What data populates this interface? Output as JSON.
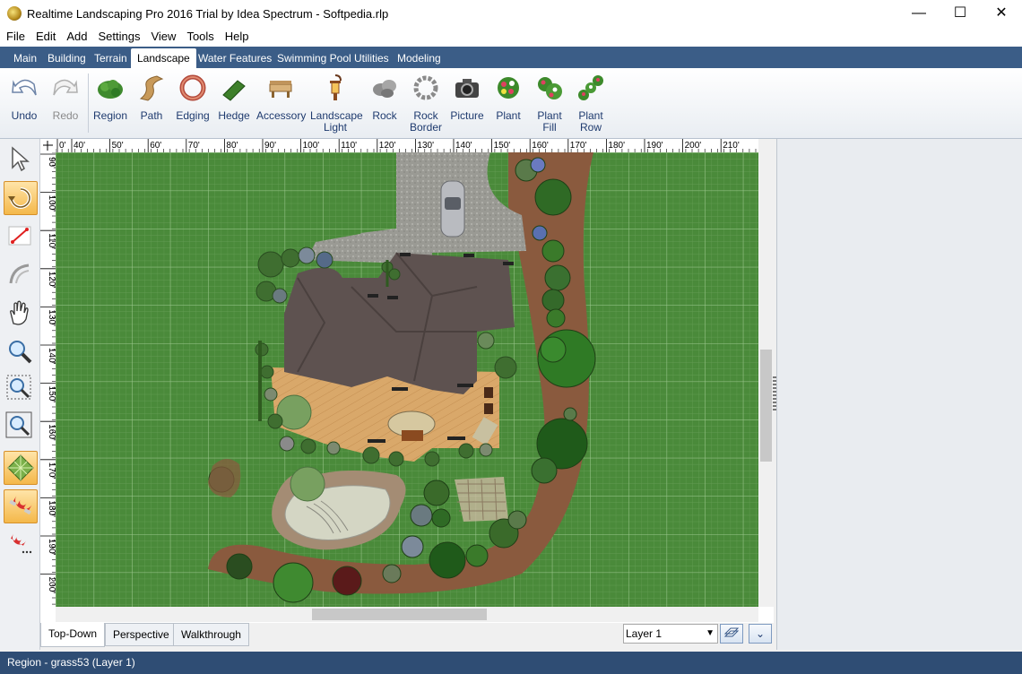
{
  "window": {
    "title": "Realtime Landscaping Pro 2016 Trial by Idea Spectrum - Softpedia.rlp",
    "minimize": "—",
    "maximize": "☐",
    "close": "✕"
  },
  "menu": [
    "File",
    "Edit",
    "Add",
    "Settings",
    "View",
    "Tools",
    "Help"
  ],
  "tabs": [
    "Main",
    "Building",
    "Terrain",
    "Landscape",
    "Water Features",
    "Swimming Pool",
    "Utilities",
    "Modeling"
  ],
  "active_tab": "Landscape",
  "ribbon": {
    "undo": "Undo",
    "redo": "Redo",
    "items": [
      {
        "line1": "Region",
        "line2": "",
        "icon": "region-icon"
      },
      {
        "line1": "Path",
        "line2": "",
        "icon": "path-icon"
      },
      {
        "line1": "Edging",
        "line2": "",
        "icon": "edging-icon"
      },
      {
        "line1": "Hedge",
        "line2": "",
        "icon": "hedge-icon"
      },
      {
        "line1": "Accessory",
        "line2": "",
        "icon": "accessory-icon"
      },
      {
        "line1": "Landscape",
        "line2": "Light",
        "icon": "lantern-icon"
      },
      {
        "line1": "Rock",
        "line2": "",
        "icon": "rock-icon"
      },
      {
        "line1": "Rock",
        "line2": "Border",
        "icon": "rock-border-icon"
      },
      {
        "line1": "Picture",
        "line2": "",
        "icon": "camera-icon"
      },
      {
        "line1": "Plant",
        "line2": "",
        "icon": "plant-icon"
      },
      {
        "line1": "Plant",
        "line2": "Fill",
        "icon": "plant-fill-icon"
      },
      {
        "line1": "Plant",
        "line2": "Row",
        "icon": "plant-row-icon"
      }
    ]
  },
  "ruler": {
    "top": [
      "0'",
      "40'",
      "50'",
      "60'",
      "70'",
      "80'",
      "90'",
      "100'",
      "110'",
      "120'",
      "130'",
      "140'",
      "150'",
      "160'",
      "170'",
      "180'",
      "190'",
      "200'",
      "210'"
    ],
    "left": [
      "90'",
      "100'",
      "110'",
      "120'",
      "130'",
      "140'",
      "150'",
      "160'",
      "170'",
      "180'",
      "190'",
      "200'"
    ]
  },
  "view_tabs": [
    "Top-Down",
    "Perspective",
    "Walkthrough"
  ],
  "active_view": "Top-Down",
  "layer_select": {
    "value": "Layer 1"
  },
  "status": "Region - grass53 (Layer 1)",
  "colors": {
    "tabstrip": "#3b5d87",
    "status": "#2f4d74",
    "grass": "#4a8a3a",
    "deck": "#d9a86a",
    "roof": "#5e5250",
    "mulch": "#8a5a3e"
  }
}
